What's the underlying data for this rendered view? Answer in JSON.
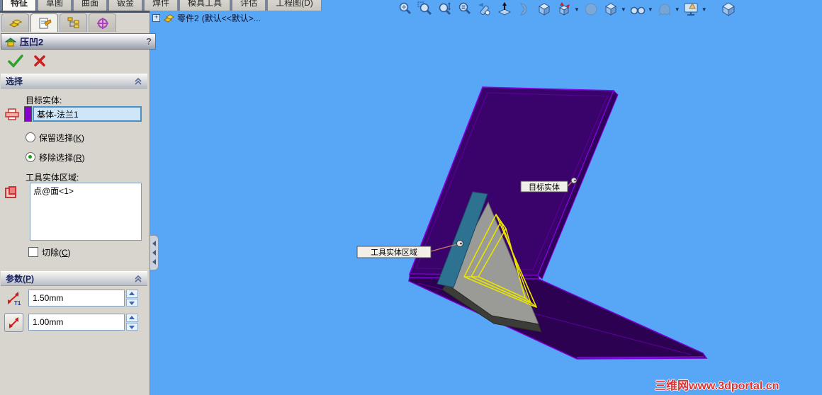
{
  "command_tabs": {
    "items": [
      {
        "id": "features",
        "label": "特征",
        "active": true
      },
      {
        "id": "sketch",
        "label": "草图",
        "active": false
      },
      {
        "id": "surfaces",
        "label": "曲面",
        "active": false
      },
      {
        "id": "sheet-metal",
        "label": "钣金",
        "active": false
      },
      {
        "id": "weldments",
        "label": "焊件",
        "active": false
      },
      {
        "id": "mold-tools",
        "label": "模具工具",
        "active": false
      },
      {
        "id": "evaluate",
        "label": "评估",
        "active": false
      },
      {
        "id": "drawing",
        "label": "工程图(D)",
        "active": false
      }
    ]
  },
  "panel_tabs": {
    "icons": [
      "feature-manager-tree",
      "property-manager",
      "configuration-manager",
      "dimxpert"
    ],
    "active_index": 1
  },
  "feature_tree": {
    "expand_glyph": "+",
    "part_name": "零件2",
    "config_text": "(默认<<默认>..."
  },
  "property_manager": {
    "title": "压凹2",
    "help_glyph": "?",
    "selection_group": {
      "header": "选择",
      "target_label": "目标实体:",
      "target_value": "基体-法兰1",
      "target_swatch_color": "#8800cc",
      "keep_radio_pre": "保留选择(",
      "keep_radio_key": "K",
      "keep_radio_post": ")",
      "remove_radio_pre": "移除选择(",
      "remove_radio_key": "R",
      "remove_radio_post": ")",
      "remove_selected": true,
      "tool_label": "工具实体区域:",
      "tool_items": [
        "点@面<1>"
      ],
      "cut_pre": "切除(",
      "cut_key": "C",
      "cut_post": ")",
      "cut_checked": false
    },
    "params_group": {
      "header_pre": "参数(",
      "header_key": "P",
      "header_post": ")",
      "thickness_value": "1.50mm",
      "thickness_icon": "indent-thickness-t1",
      "clearance_value": "1.00mm",
      "clearance_icon": "indent-clearance"
    }
  },
  "view_toolbar": {
    "icons": [
      "zoom-to-fit",
      "zoom-to-area",
      "zoom-in-out",
      "zoom-to-selection",
      "rotate-view",
      "normal-to",
      "section-view",
      "isometric-view",
      "view-orientation",
      "perspective",
      "display-style",
      "hide-show-items",
      "appearances",
      "apply-scene",
      "view-cube"
    ]
  },
  "viewport": {
    "background_color": "#58a6f6",
    "callouts": [
      {
        "text": "目标实体"
      },
      {
        "text": "工具实体区域"
      }
    ],
    "watermark": "三维网www.3dportal.cn",
    "model_colors": {
      "upper_face": "#3a026b",
      "lower_face": "#2c0152",
      "edge": "#8a00e8",
      "tool_gray": "#9a9a96",
      "tool_dark": "#3c3c38",
      "tool_teal": "#2e7292",
      "sketch_yellow": "#e8e400"
    }
  }
}
